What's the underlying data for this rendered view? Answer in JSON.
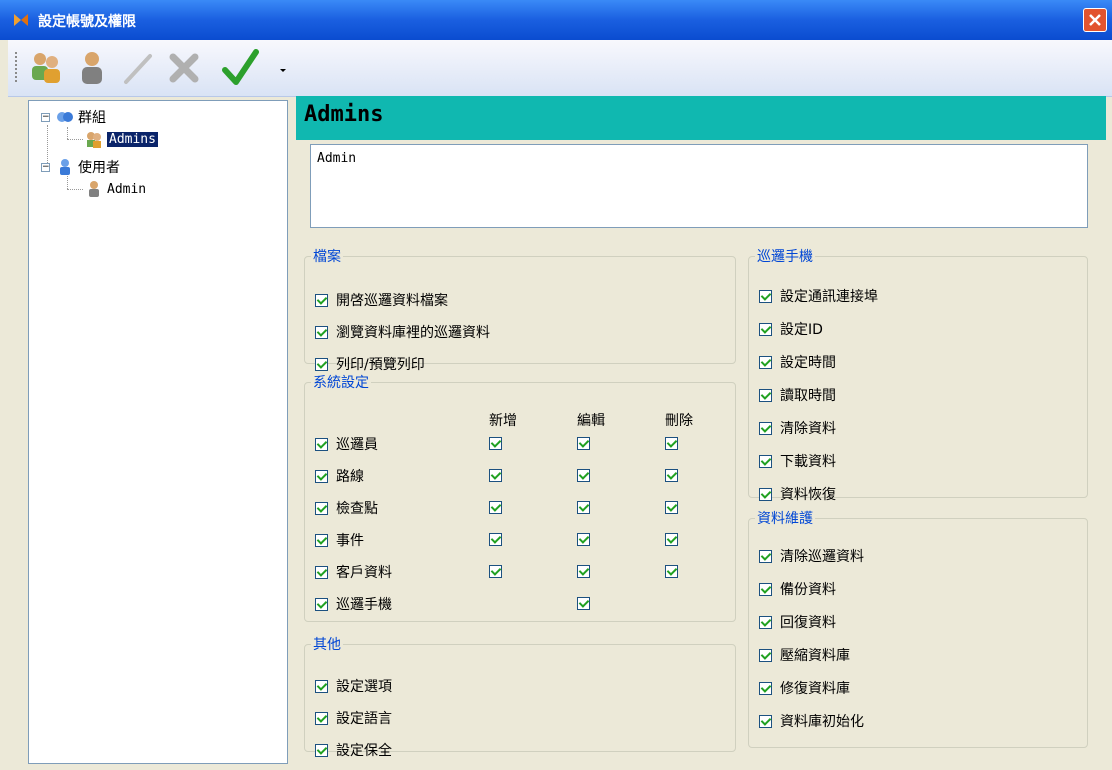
{
  "window": {
    "title": "設定帳號及權限"
  },
  "toolbar": {
    "buttons": [
      "add-group",
      "add-user",
      "edit",
      "delete",
      "apply"
    ]
  },
  "tree": {
    "group_label": "群組",
    "group_child": "Admins",
    "user_label": "使用者",
    "user_child": "Admin"
  },
  "main": {
    "header": "Admins",
    "description": "Admin"
  },
  "files": {
    "legend": "檔案",
    "items": [
      "開啓巡邏資料檔案",
      "瀏覽資料庫裡的巡邏資料",
      "列印/預覽列印"
    ]
  },
  "system": {
    "legend": "系統設定",
    "columns": [
      "新增",
      "編輯",
      "刪除"
    ],
    "rows": [
      {
        "label": "巡邏員",
        "add": true,
        "edit": true,
        "del": true
      },
      {
        "label": "路線",
        "add": true,
        "edit": true,
        "del": true
      },
      {
        "label": "檢查點",
        "add": true,
        "edit": true,
        "del": true
      },
      {
        "label": "事件",
        "add": true,
        "edit": true,
        "del": true
      },
      {
        "label": "客戶資料",
        "add": true,
        "edit": true,
        "del": true
      },
      {
        "label": "巡邏手機",
        "add": false,
        "edit": true,
        "del": false
      }
    ]
  },
  "other": {
    "legend": "其他",
    "items": [
      "設定選項",
      "設定語言",
      "設定保全"
    ]
  },
  "device": {
    "legend": "巡邏手機",
    "items": [
      "設定通訊連接埠",
      "設定ID",
      "設定時間",
      "讀取時間",
      "清除資料",
      "下載資料",
      "資料恢復"
    ]
  },
  "maintenance": {
    "legend": "資料維護",
    "items": [
      "清除巡邏資料",
      "備份資料",
      "回復資料",
      "壓縮資料庫",
      "修復資料庫",
      "資料庫初始化"
    ]
  }
}
